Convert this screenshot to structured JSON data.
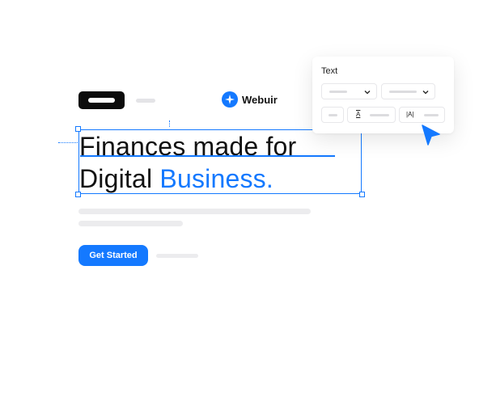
{
  "header": {
    "brand_name": "Webuir",
    "brand_icon": "sparkle-icon"
  },
  "hero": {
    "headline_part1": "Finances made for",
    "headline_part2": "Digital ",
    "headline_highlight": "Business.",
    "cta_label": "Get Started"
  },
  "text_panel": {
    "title": "Text",
    "align_icon": "A",
    "letter_spacing_icon": "|A|"
  },
  "colors": {
    "accent": "#1479ff",
    "text": "#111111",
    "logo": "#0c0c0c"
  }
}
